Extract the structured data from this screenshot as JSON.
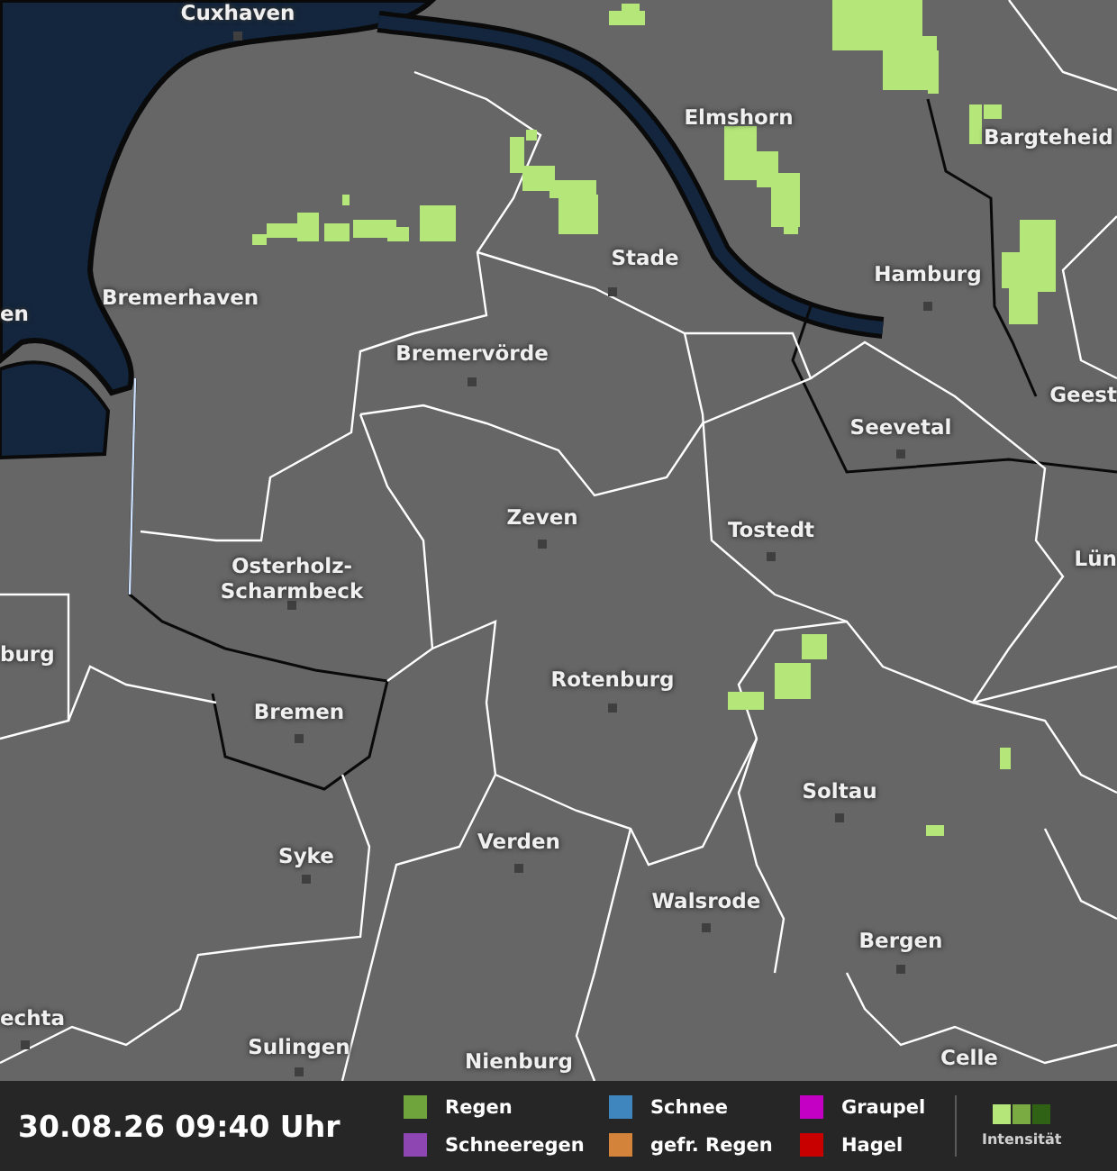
{
  "map": {
    "places": [
      {
        "name": "Cuxhaven"
      },
      {
        "name": "Elmshorn"
      },
      {
        "name": "Bargteheid"
      },
      {
        "name": "en"
      },
      {
        "name": "Bremerhaven"
      },
      {
        "name": "Stade"
      },
      {
        "name": "Hamburg"
      },
      {
        "name": "Bremervörde"
      },
      {
        "name": "Geest"
      },
      {
        "name": "Seevetal"
      },
      {
        "name": "Zeven"
      },
      {
        "name": "Tostedt"
      },
      {
        "name": "Osterholz-Scharmbeck"
      },
      {
        "name": "Lün"
      },
      {
        "name": "burg"
      },
      {
        "name": "Rotenburg"
      },
      {
        "name": "Bremen"
      },
      {
        "name": "Soltau"
      },
      {
        "name": "Syke"
      },
      {
        "name": "Verden"
      },
      {
        "name": "Walsrode"
      },
      {
        "name": "Bergen"
      },
      {
        "name": "echta"
      },
      {
        "name": "Sulingen"
      },
      {
        "name": "Nienburg"
      },
      {
        "name": "Celle"
      }
    ]
  },
  "legend": {
    "timestamp": "30.08.26 09:40 Uhr",
    "precipitation_types": [
      {
        "label": "Regen",
        "color": "#6fa33c"
      },
      {
        "label": "Schnee",
        "color": "#3f86bf"
      },
      {
        "label": "Graupel",
        "color": "#c400c4"
      },
      {
        "label": "Schneeregen",
        "color": "#8e46b2"
      },
      {
        "label": "gefr. Regen",
        "color": "#d3843a"
      },
      {
        "label": "Hagel",
        "color": "#c80000"
      }
    ],
    "intensity_steps": [
      {
        "color": "#b4e67a"
      },
      {
        "color": "#7aab42"
      },
      {
        "color": "#2f6214"
      }
    ],
    "intensity_label": "Intensität"
  }
}
